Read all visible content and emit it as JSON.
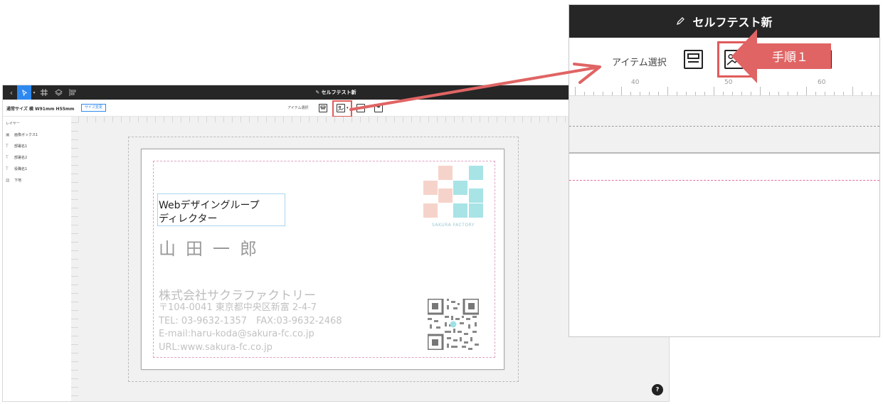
{
  "window_title": "セルフテスト新",
  "size_info": {
    "label": "通常サイズ 横 W91mm H55mm",
    "change_button": "サイズ変更"
  },
  "item_select_label": "アイテム選択",
  "layers": {
    "title": "レイヤー",
    "items": [
      {
        "icon": "image-box-icon",
        "label": "画像ボックス1"
      },
      {
        "icon": "text-icon",
        "label": "部署名1"
      },
      {
        "icon": "text-icon",
        "label": "部署名2"
      },
      {
        "icon": "text-icon",
        "label": "役職名1"
      },
      {
        "icon": "background-icon",
        "label": "下地"
      }
    ]
  },
  "card": {
    "department_line1": "Webデザイングループ",
    "department_line2": "ディレクター",
    "name": "山田一郎",
    "company": "株式会社サクラファクトリー",
    "address": "〒104-0041 東京都中央区新富 2-4-7",
    "tel": "TEL: 03-9632-1357　FAX:03-9632-2468",
    "email": "E-mail:haru-koda@sakura-fc.co.jp",
    "url": "URL:www.sakura-fc.co.jp",
    "logo_text": "SAKURA FACTORY"
  },
  "help_label": "?",
  "zoom": {
    "title": "セルフテスト新",
    "item_select_label": "アイテム選択",
    "ruler_numbers": [
      "40",
      "50",
      "60"
    ]
  },
  "step_label": "手順１",
  "colors": {
    "accent_blue": "#2d89ef",
    "highlight_red": "#e05b5b",
    "topbar": "#262626",
    "logo_pink": "#f6c9bf",
    "logo_teal": "#9fe0e4"
  }
}
